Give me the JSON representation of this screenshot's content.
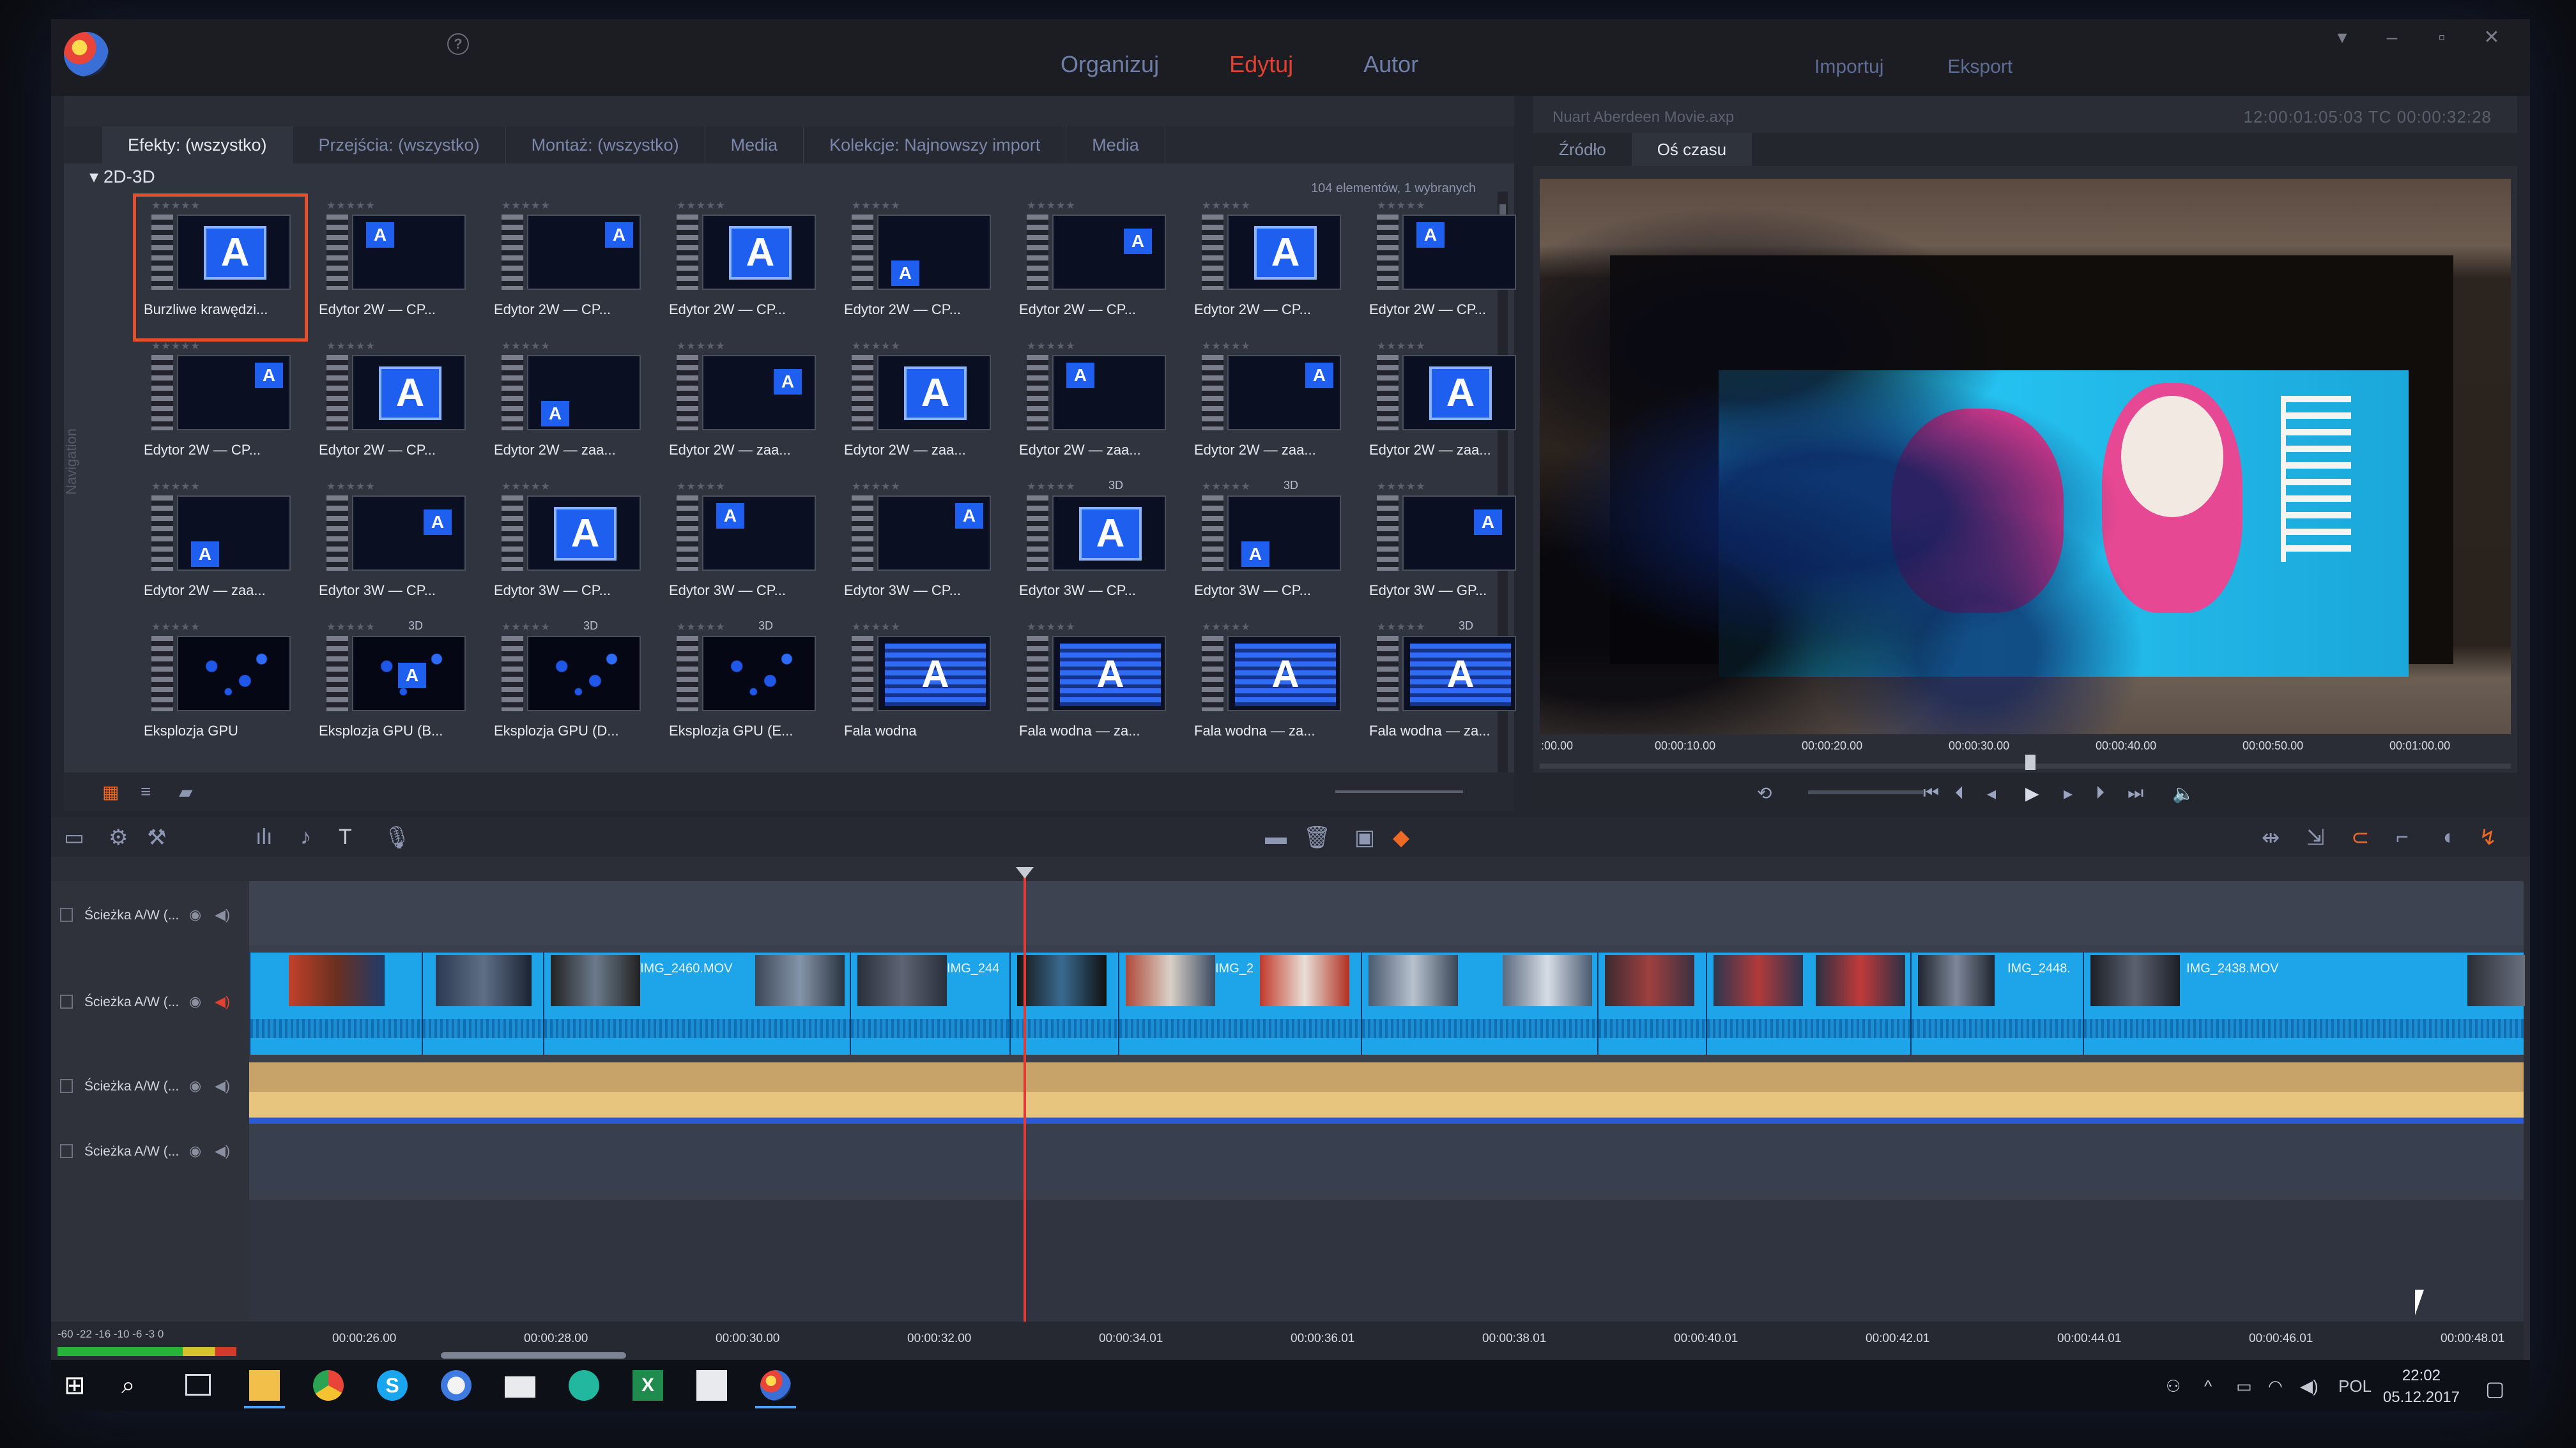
{
  "titlebar": {
    "main_tabs": [
      "Organizuj",
      "Edytuj",
      "Autor"
    ],
    "active_tab": "Edytuj",
    "io_tabs": [
      "Importuj",
      "Eksport"
    ]
  },
  "library": {
    "tabs": [
      "Efekty: (wszystko)",
      "Przejścia: (wszystko)",
      "Montaż: (wszystko)",
      "Media",
      "Kolekcje: Najnowszy import",
      "Media"
    ],
    "category": "2D-3D",
    "count": "104 elementów, 1 wybranych",
    "nav_label": "Navigation",
    "tiles": [
      "Burzliwe krawędzi...",
      "Edytor 2W — CP...",
      "Edytor 2W — CP...",
      "Edytor 2W — CP...",
      "Edytor 2W — CP...",
      "Edytor 2W — CP...",
      "Edytor 2W — CP...",
      "Edytor 2W — CP...",
      "Edytor 2W — CP...",
      "Edytor 2W — CP...",
      "Edytor 2W — zaa...",
      "Edytor 2W — zaa...",
      "Edytor 2W — zaa...",
      "Edytor 2W — zaa...",
      "Edytor 2W — zaa...",
      "Edytor 2W — zaa...",
      "Edytor 2W — zaa...",
      "Edytor 3W — CP...",
      "Edytor 3W — CP...",
      "Edytor 3W — CP...",
      "Edytor 3W — CP...",
      "Edytor 3W — CP...",
      "Edytor 3W — CP...",
      "Edytor 3W — GP...",
      "Eksplozja GPU",
      "Eksplozja GPU (B...",
      "Eksplozja GPU (D...",
      "Eksplozja GPU (E...",
      "Fala wodna",
      "Fala wodna — za...",
      "Fala wodna — za...",
      "Fala wodna — za..."
    ],
    "tile_3d_badge": "3D"
  },
  "player": {
    "title": "Nuart Aberdeen Movie.axp",
    "timecode": "12:00:01:05:03  TC 00:00:32:28",
    "tabs": [
      "Źródło",
      "Oś czasu"
    ],
    "active_tab": "Oś czasu",
    "ruler": [
      ":00.00",
      "00:00:10.00",
      "00:00:20.00",
      "00:00:30.00",
      "00:00:40.00",
      "00:00:50.00",
      "00:01:00.00"
    ],
    "position_fraction": 0.5
  },
  "timeline": {
    "tracks": [
      "Ścieżka A/W (...",
      "Ścieżka A/W (...",
      "Ścieżka A/W (...",
      "Ścieżka A/W (..."
    ],
    "clips": [
      "IMG_2460.MOV",
      "IMG_244",
      "IMG_2",
      "IMG_2448.",
      "IMG_2438.MOV"
    ],
    "ruler": [
      "00:00:26.00",
      "00:00:28.00",
      "00:00:30.00",
      "00:00:32.00",
      "00:00:34.01",
      "00:00:36.01",
      "00:00:38.01",
      "00:00:40.01",
      "00:00:42.01",
      "00:00:44.01",
      "00:00:46.01",
      "00:00:48.01"
    ],
    "meter_scale": "-60  -22 -16  -10   -6  -3   0"
  },
  "taskbar": {
    "language": "POL",
    "time": "22:02",
    "date": "05.12.2017"
  },
  "colors": {
    "accent": "#e4402f",
    "clip_blue": "#1ea4e8",
    "playhead": "#e23b36"
  }
}
